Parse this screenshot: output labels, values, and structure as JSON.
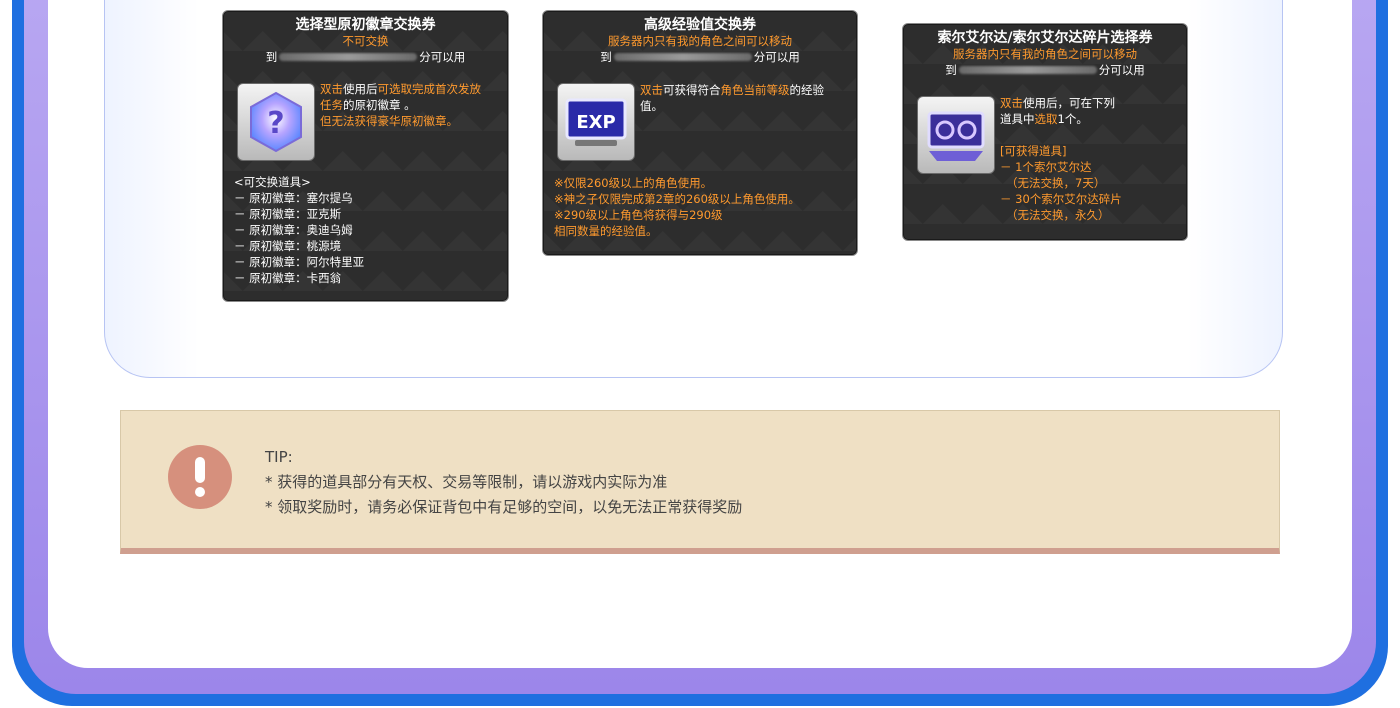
{
  "card1": {
    "title": "选择型原初徽章交换券",
    "subtitle": "不可交换",
    "date_prefix": "到",
    "date_suffix": "分可以用",
    "desc_line1_a": "双击",
    "desc_line1_b": "使用后",
    "desc_line1_c": "可选取完成首次发放",
    "desc_line2_a": "任务",
    "desc_line2_b": "的原初徽章 。",
    "desc_line3": "但无法获得豪华原初徽章。",
    "list_header": "<可交换道具>",
    "items": [
      "－ 原初徽章：塞尔提乌",
      "－ 原初徽章：亚克斯",
      "－ 原初徽章：奥迪乌姆",
      "－ 原初徽章：桃源境",
      "－ 原初徽章：阿尔特里亚",
      "－ 原初徽章：卡西翁"
    ]
  },
  "card2": {
    "title": "高级经验值交换券",
    "subtitle": "服务器内只有我的角色之间可以移动",
    "date_prefix": "到",
    "date_suffix": "分可以用",
    "desc_line1_a": "双击",
    "desc_line1_b": "可获得符合",
    "desc_line1_c": "角色当前等级",
    "desc_line1_d": "的经验",
    "desc_line2": "值。",
    "icon_label": "EXP",
    "notes": [
      "※仅限260级以上的角色使用。",
      "※神之子仅限完成第2章的260级以上角色使用。",
      "※290级以上角色将获得与290级",
      "相同数量的经验值。"
    ]
  },
  "card3": {
    "title": "索尔艾尔达/索尔艾尔达碎片选择券",
    "subtitle": "服务器内只有我的角色之间可以移动",
    "date_prefix": "到",
    "date_suffix": "分可以用",
    "desc_line1_a": "双击",
    "desc_line1_b": "使用后，可在下列",
    "desc_line2_a": "道具中",
    "desc_line2_b": "选取",
    "desc_line2_c": "1个。",
    "list_header": "[可获得道具]",
    "items": [
      "－ 1个索尔艾尔达",
      "（无法交换，7天）",
      "－ 30个索尔艾尔达碎片",
      "（无法交换，永久）"
    ]
  },
  "tip": {
    "heading": "TIP:",
    "line1": "* 获得的道具部分有天权、交易等限制，请以游戏内实际为准",
    "line2": "* 领取奖励时，请务必保证背包中有足够的空间，以免无法正常获得奖励"
  },
  "colors": {
    "frame_blue": "#1f6fe0",
    "frame_purple": "#a592ee",
    "card_bg": "#2d2d2d",
    "orange_text": "#ff9a2e",
    "tip_bg": "#efe0c4",
    "tip_icon": "#d6907d"
  }
}
